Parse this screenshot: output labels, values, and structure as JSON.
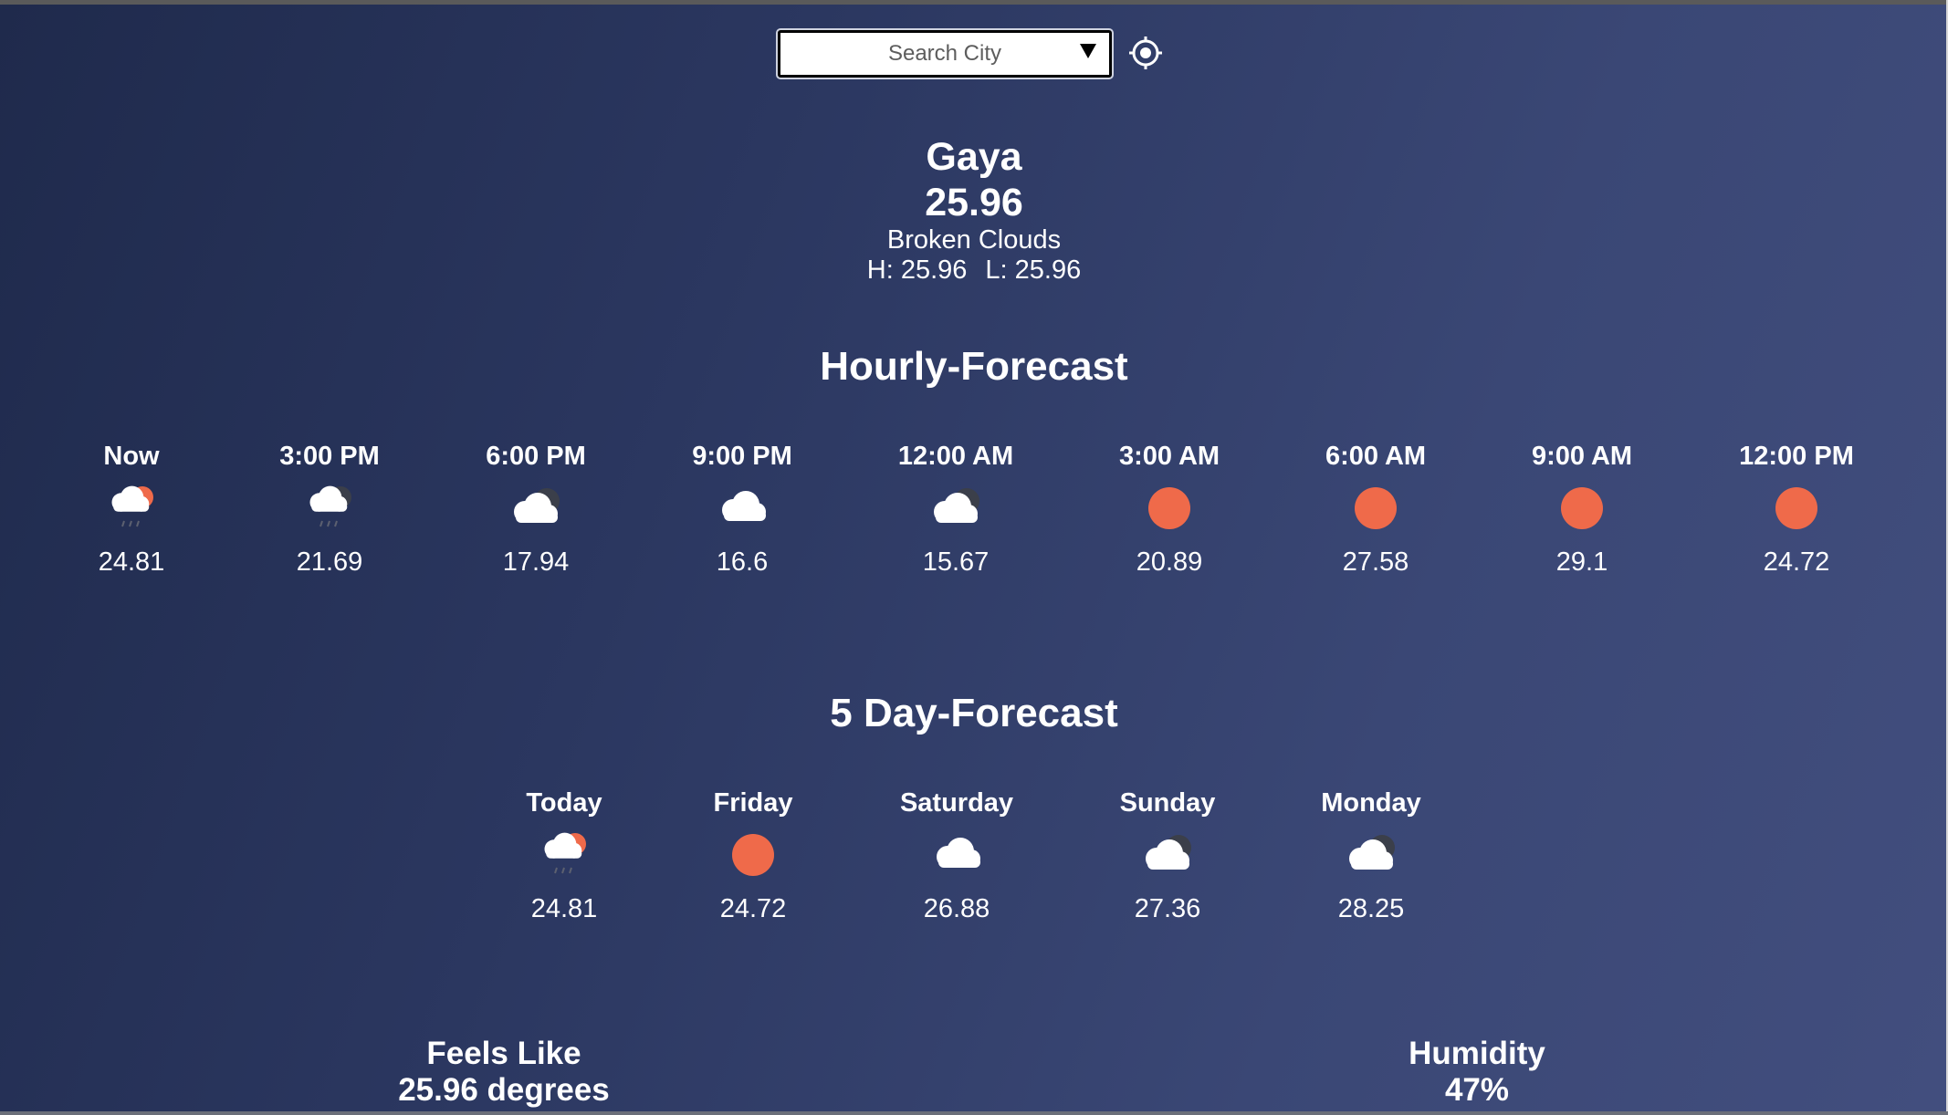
{
  "search": {
    "placeholder": "Search City"
  },
  "current": {
    "city": "Gaya",
    "temperature": "25.96",
    "description": "Broken Clouds",
    "high": "H: 25.96",
    "low": "L: 25.96"
  },
  "hourly": {
    "title": "Hourly-Forecast",
    "items": [
      {
        "time": "Now",
        "temp": "24.81",
        "icon": "rain-sun-icon"
      },
      {
        "time": "3:00 PM",
        "temp": "21.69",
        "icon": "rain-moon-icon"
      },
      {
        "time": "6:00 PM",
        "temp": "17.94",
        "icon": "cloud-moon-icon"
      },
      {
        "time": "9:00 PM",
        "temp": "16.6",
        "icon": "cloud-icon"
      },
      {
        "time": "12:00 AM",
        "temp": "15.67",
        "icon": "cloud-moon-icon"
      },
      {
        "time": "3:00 AM",
        "temp": "20.89",
        "icon": "sun-icon"
      },
      {
        "time": "6:00 AM",
        "temp": "27.58",
        "icon": "sun-icon"
      },
      {
        "time": "9:00 AM",
        "temp": "29.1",
        "icon": "sun-icon"
      },
      {
        "time": "12:00 PM",
        "temp": "24.72",
        "icon": "sun-icon"
      }
    ]
  },
  "daily": {
    "title": "5 Day-Forecast",
    "items": [
      {
        "day": "Today",
        "temp": "24.81",
        "icon": "rain-sun-icon"
      },
      {
        "day": "Friday",
        "temp": "24.72",
        "icon": "sun-icon"
      },
      {
        "day": "Saturday",
        "temp": "26.88",
        "icon": "cloud-icon"
      },
      {
        "day": "Sunday",
        "temp": "27.36",
        "icon": "cloud-moon-icon"
      },
      {
        "day": "Monday",
        "temp": "28.25",
        "icon": "cloud-moon-icon"
      }
    ]
  },
  "stats": {
    "feels_like_label": "Feels Like",
    "feels_like_value": "25.96 degrees",
    "humidity_label": "Humidity",
    "humidity_value": "47%"
  },
  "colors": {
    "sun": "#ef6a4a",
    "cloud": "#ffffff",
    "moon": "#3b3f4a",
    "rain": "#5c6070"
  }
}
